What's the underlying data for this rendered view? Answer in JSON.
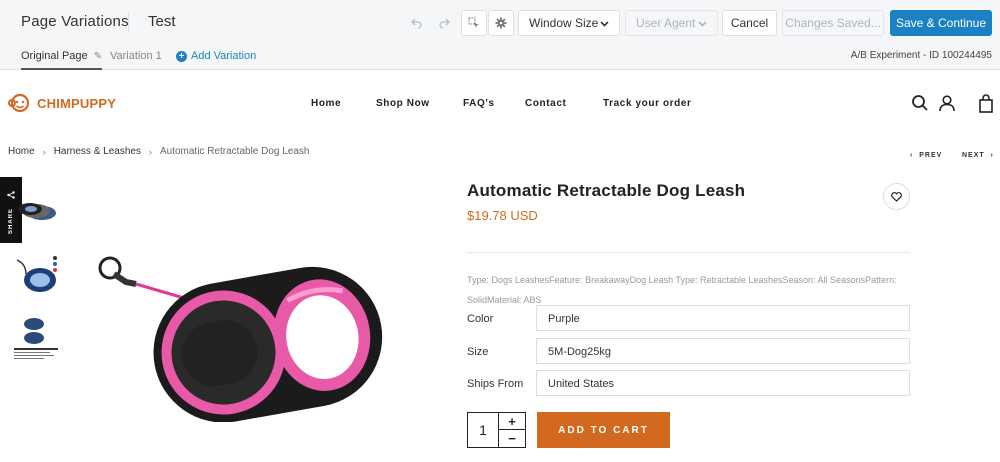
{
  "editor": {
    "title": "Page Variations",
    "test_name": "Test",
    "window_size_label": "Window Size",
    "user_agent_label": "User Agent",
    "cancel_label": "Cancel",
    "saved_label": "Changes Saved...",
    "save_label": "Save & Continue",
    "variations": {
      "original": "Original Page",
      "variation1": "Variation 1",
      "add": "Add Variation"
    },
    "experiment_id": "A/B Experiment - ID 100244495"
  },
  "site": {
    "logo_text": "CHIMPUPPY",
    "nav": [
      "Home",
      "Shop Now",
      "FAQ's",
      "Contact",
      "Track your order"
    ],
    "breadcrumb": [
      "Home",
      "Harness & Leashes",
      "Automatic Retractable Dog Leash"
    ],
    "prev_label": "PREV",
    "next_label": "NEXT",
    "share_label": "SHARE"
  },
  "product": {
    "title": "Automatic Retractable Dog Leash",
    "price": "$19.78 USD",
    "description": "Type: Dogs LeashesFeature: BreakawayDog Leash Type: Retractable LeashesSeason: All SeasonsPattern: SolidMaterial: ABS",
    "options": [
      {
        "label": "Color",
        "value": "Purple"
      },
      {
        "label": "Size",
        "value": "5M-Dog25kg"
      },
      {
        "label": "Ships From",
        "value": "United States"
      }
    ],
    "quantity": "1",
    "add_to_cart_label": "ADD TO CART",
    "accent_color": "#d2691e"
  }
}
